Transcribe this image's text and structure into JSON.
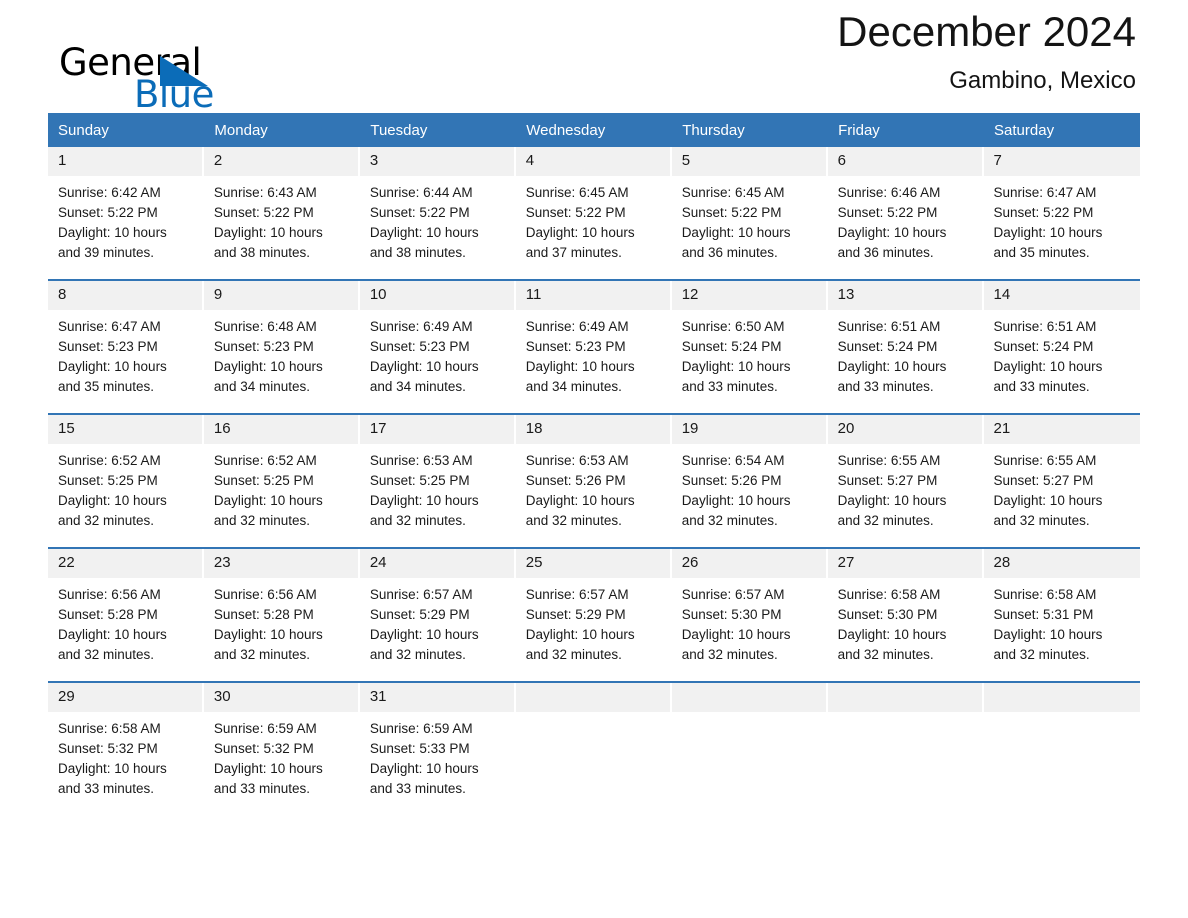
{
  "brand": {
    "name_top": "General",
    "name_bottom": "Blue",
    "triangle_icon": "blue-triangle-icon"
  },
  "header": {
    "title": "December 2024",
    "location": "Gambino, Mexico"
  },
  "colors": {
    "header_blue": "#3275b5",
    "brand_blue": "#0b6cb8",
    "daynum_band": "#f1f1f1",
    "text": "#1a1a1a"
  },
  "weekday_headers": [
    "Sunday",
    "Monday",
    "Tuesday",
    "Wednesday",
    "Thursday",
    "Friday",
    "Saturday"
  ],
  "weeks": [
    [
      {
        "day": "1",
        "sunrise": "Sunrise: 6:42 AM",
        "sunset": "Sunset: 5:22 PM",
        "daylight_1": "Daylight: 10 hours",
        "daylight_2": "and 39 minutes."
      },
      {
        "day": "2",
        "sunrise": "Sunrise: 6:43 AM",
        "sunset": "Sunset: 5:22 PM",
        "daylight_1": "Daylight: 10 hours",
        "daylight_2": "and 38 minutes."
      },
      {
        "day": "3",
        "sunrise": "Sunrise: 6:44 AM",
        "sunset": "Sunset: 5:22 PM",
        "daylight_1": "Daylight: 10 hours",
        "daylight_2": "and 38 minutes."
      },
      {
        "day": "4",
        "sunrise": "Sunrise: 6:45 AM",
        "sunset": "Sunset: 5:22 PM",
        "daylight_1": "Daylight: 10 hours",
        "daylight_2": "and 37 minutes."
      },
      {
        "day": "5",
        "sunrise": "Sunrise: 6:45 AM",
        "sunset": "Sunset: 5:22 PM",
        "daylight_1": "Daylight: 10 hours",
        "daylight_2": "and 36 minutes."
      },
      {
        "day": "6",
        "sunrise": "Sunrise: 6:46 AM",
        "sunset": "Sunset: 5:22 PM",
        "daylight_1": "Daylight: 10 hours",
        "daylight_2": "and 36 minutes."
      },
      {
        "day": "7",
        "sunrise": "Sunrise: 6:47 AM",
        "sunset": "Sunset: 5:22 PM",
        "daylight_1": "Daylight: 10 hours",
        "daylight_2": "and 35 minutes."
      }
    ],
    [
      {
        "day": "8",
        "sunrise": "Sunrise: 6:47 AM",
        "sunset": "Sunset: 5:23 PM",
        "daylight_1": "Daylight: 10 hours",
        "daylight_2": "and 35 minutes."
      },
      {
        "day": "9",
        "sunrise": "Sunrise: 6:48 AM",
        "sunset": "Sunset: 5:23 PM",
        "daylight_1": "Daylight: 10 hours",
        "daylight_2": "and 34 minutes."
      },
      {
        "day": "10",
        "sunrise": "Sunrise: 6:49 AM",
        "sunset": "Sunset: 5:23 PM",
        "daylight_1": "Daylight: 10 hours",
        "daylight_2": "and 34 minutes."
      },
      {
        "day": "11",
        "sunrise": "Sunrise: 6:49 AM",
        "sunset": "Sunset: 5:23 PM",
        "daylight_1": "Daylight: 10 hours",
        "daylight_2": "and 34 minutes."
      },
      {
        "day": "12",
        "sunrise": "Sunrise: 6:50 AM",
        "sunset": "Sunset: 5:24 PM",
        "daylight_1": "Daylight: 10 hours",
        "daylight_2": "and 33 minutes."
      },
      {
        "day": "13",
        "sunrise": "Sunrise: 6:51 AM",
        "sunset": "Sunset: 5:24 PM",
        "daylight_1": "Daylight: 10 hours",
        "daylight_2": "and 33 minutes."
      },
      {
        "day": "14",
        "sunrise": "Sunrise: 6:51 AM",
        "sunset": "Sunset: 5:24 PM",
        "daylight_1": "Daylight: 10 hours",
        "daylight_2": "and 33 minutes."
      }
    ],
    [
      {
        "day": "15",
        "sunrise": "Sunrise: 6:52 AM",
        "sunset": "Sunset: 5:25 PM",
        "daylight_1": "Daylight: 10 hours",
        "daylight_2": "and 32 minutes."
      },
      {
        "day": "16",
        "sunrise": "Sunrise: 6:52 AM",
        "sunset": "Sunset: 5:25 PM",
        "daylight_1": "Daylight: 10 hours",
        "daylight_2": "and 32 minutes."
      },
      {
        "day": "17",
        "sunrise": "Sunrise: 6:53 AM",
        "sunset": "Sunset: 5:25 PM",
        "daylight_1": "Daylight: 10 hours",
        "daylight_2": "and 32 minutes."
      },
      {
        "day": "18",
        "sunrise": "Sunrise: 6:53 AM",
        "sunset": "Sunset: 5:26 PM",
        "daylight_1": "Daylight: 10 hours",
        "daylight_2": "and 32 minutes."
      },
      {
        "day": "19",
        "sunrise": "Sunrise: 6:54 AM",
        "sunset": "Sunset: 5:26 PM",
        "daylight_1": "Daylight: 10 hours",
        "daylight_2": "and 32 minutes."
      },
      {
        "day": "20",
        "sunrise": "Sunrise: 6:55 AM",
        "sunset": "Sunset: 5:27 PM",
        "daylight_1": "Daylight: 10 hours",
        "daylight_2": "and 32 minutes."
      },
      {
        "day": "21",
        "sunrise": "Sunrise: 6:55 AM",
        "sunset": "Sunset: 5:27 PM",
        "daylight_1": "Daylight: 10 hours",
        "daylight_2": "and 32 minutes."
      }
    ],
    [
      {
        "day": "22",
        "sunrise": "Sunrise: 6:56 AM",
        "sunset": "Sunset: 5:28 PM",
        "daylight_1": "Daylight: 10 hours",
        "daylight_2": "and 32 minutes."
      },
      {
        "day": "23",
        "sunrise": "Sunrise: 6:56 AM",
        "sunset": "Sunset: 5:28 PM",
        "daylight_1": "Daylight: 10 hours",
        "daylight_2": "and 32 minutes."
      },
      {
        "day": "24",
        "sunrise": "Sunrise: 6:57 AM",
        "sunset": "Sunset: 5:29 PM",
        "daylight_1": "Daylight: 10 hours",
        "daylight_2": "and 32 minutes."
      },
      {
        "day": "25",
        "sunrise": "Sunrise: 6:57 AM",
        "sunset": "Sunset: 5:29 PM",
        "daylight_1": "Daylight: 10 hours",
        "daylight_2": "and 32 minutes."
      },
      {
        "day": "26",
        "sunrise": "Sunrise: 6:57 AM",
        "sunset": "Sunset: 5:30 PM",
        "daylight_1": "Daylight: 10 hours",
        "daylight_2": "and 32 minutes."
      },
      {
        "day": "27",
        "sunrise": "Sunrise: 6:58 AM",
        "sunset": "Sunset: 5:30 PM",
        "daylight_1": "Daylight: 10 hours",
        "daylight_2": "and 32 minutes."
      },
      {
        "day": "28",
        "sunrise": "Sunrise: 6:58 AM",
        "sunset": "Sunset: 5:31 PM",
        "daylight_1": "Daylight: 10 hours",
        "daylight_2": "and 32 minutes."
      }
    ],
    [
      {
        "day": "29",
        "sunrise": "Sunrise: 6:58 AM",
        "sunset": "Sunset: 5:32 PM",
        "daylight_1": "Daylight: 10 hours",
        "daylight_2": "and 33 minutes."
      },
      {
        "day": "30",
        "sunrise": "Sunrise: 6:59 AM",
        "sunset": "Sunset: 5:32 PM",
        "daylight_1": "Daylight: 10 hours",
        "daylight_2": "and 33 minutes."
      },
      {
        "day": "31",
        "sunrise": "Sunrise: 6:59 AM",
        "sunset": "Sunset: 5:33 PM",
        "daylight_1": "Daylight: 10 hours",
        "daylight_2": "and 33 minutes."
      },
      {
        "day": "",
        "sunrise": "",
        "sunset": "",
        "daylight_1": "",
        "daylight_2": ""
      },
      {
        "day": "",
        "sunrise": "",
        "sunset": "",
        "daylight_1": "",
        "daylight_2": ""
      },
      {
        "day": "",
        "sunrise": "",
        "sunset": "",
        "daylight_1": "",
        "daylight_2": ""
      },
      {
        "day": "",
        "sunrise": "",
        "sunset": "",
        "daylight_1": "",
        "daylight_2": ""
      }
    ]
  ]
}
